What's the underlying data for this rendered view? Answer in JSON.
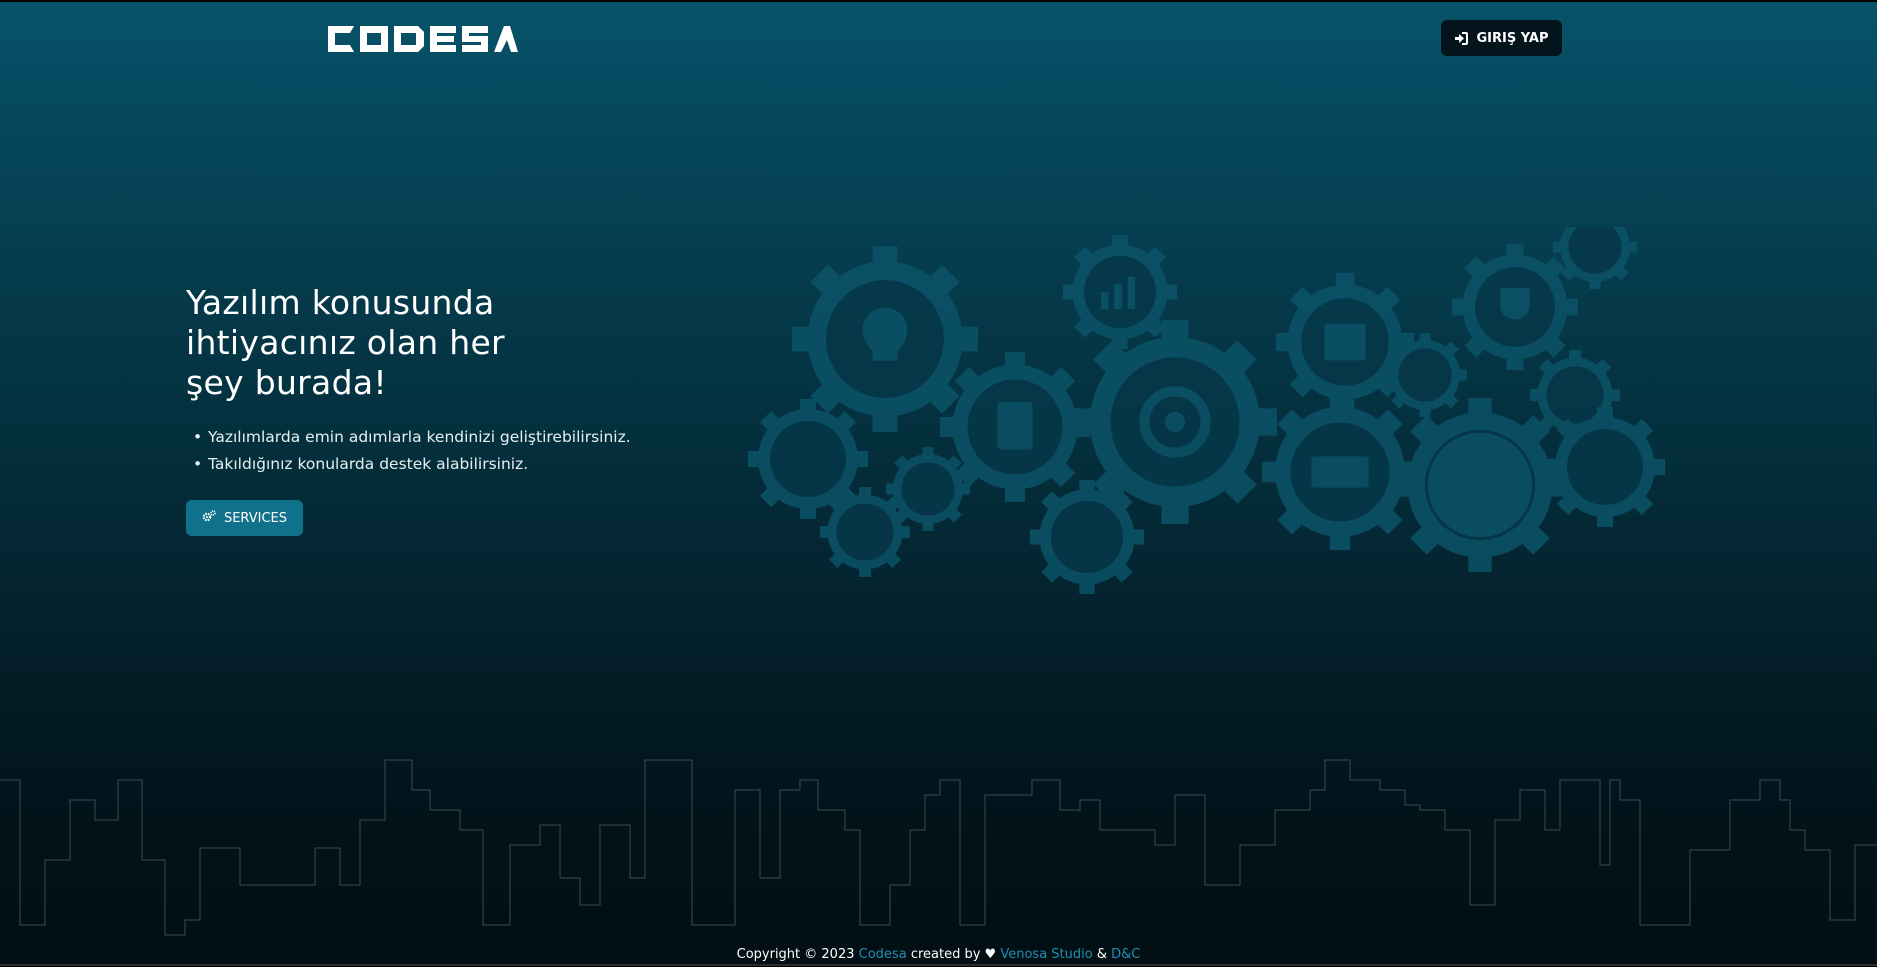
{
  "header": {
    "logo_text": "CODESA",
    "login_label": "GIRIŞ YAP",
    "login_icon": "sign-in-icon"
  },
  "hero": {
    "title_lines": [
      "Yazılım konusunda",
      "ihtiyacınız olan her",
      "şey burada!"
    ],
    "bullets": [
      "Yazılımlarda emin adımlarla kendinizi geliştirebilirsiniz.",
      "Takıldığınız konularda destek alabilirsiniz."
    ],
    "bullet_marker": "•",
    "services_label": "SERVICES",
    "services_icon": "gears-icon"
  },
  "footer": {
    "copyright": "Copyright © 2023",
    "brand_link": "Codesa",
    "created_by": "created by ♥",
    "studio_link": "Venosa Studio",
    "amp": "&",
    "partner_link": "D&C"
  },
  "colors": {
    "accent": "#10718b",
    "link": "#1f8fb3",
    "background_top": "#07536a",
    "background_bottom": "#020f14",
    "login_button": "#04141c"
  }
}
